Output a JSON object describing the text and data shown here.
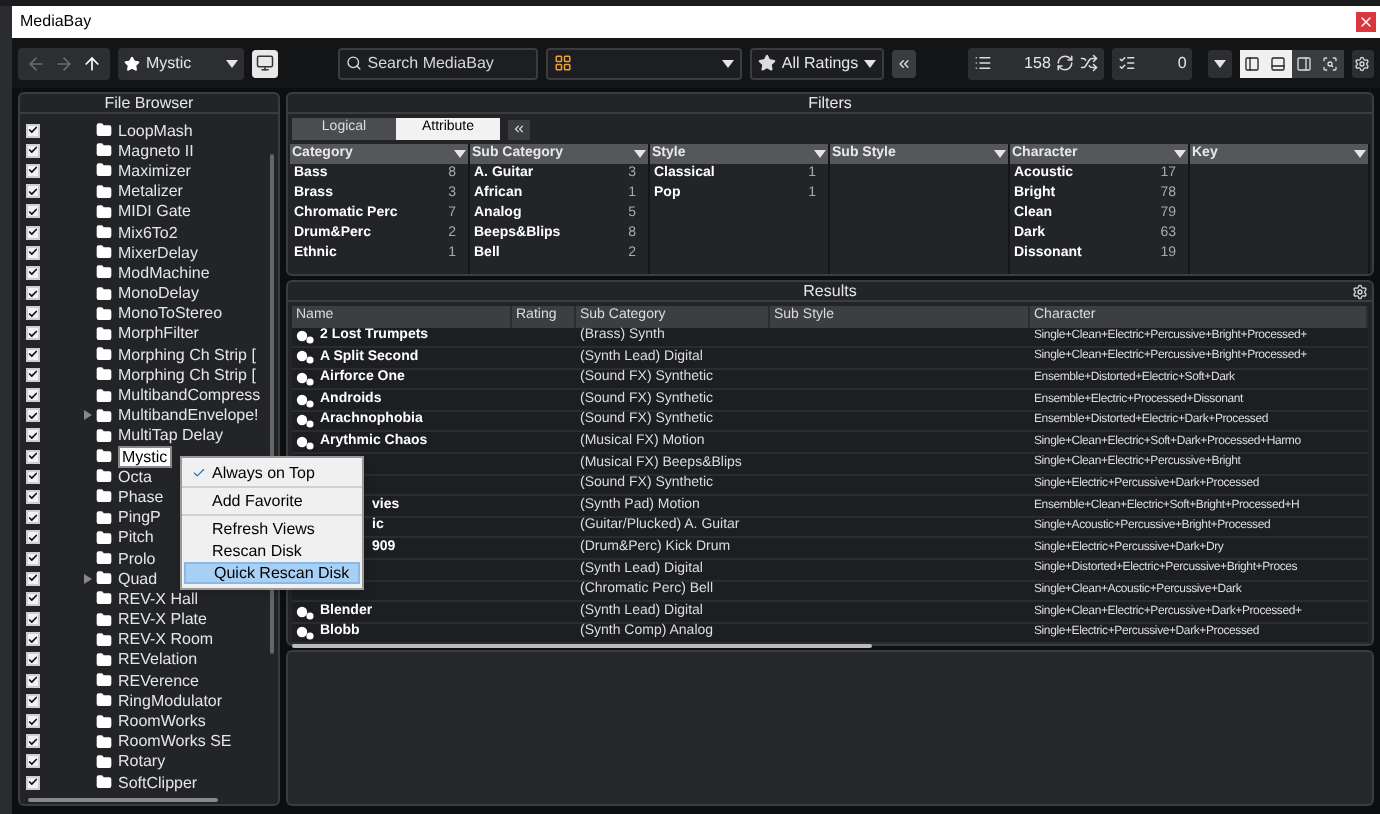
{
  "window": {
    "title": "MediaBay"
  },
  "toolbar": {
    "location": "Mystic",
    "search_placeholder": "Search MediaBay",
    "ratings": "All Ratings",
    "result_count": "158",
    "selected_count": "0",
    "layouts": [
      {
        "selected": true
      },
      {
        "selected": true
      },
      {
        "selected": false
      },
      {
        "selected": false
      }
    ]
  },
  "file_browser": {
    "title": "File Browser",
    "items": [
      {
        "name": "LoopMash",
        "checked": true,
        "expandable": false,
        "selected": false
      },
      {
        "name": "Magneto II",
        "checked": true,
        "expandable": false,
        "selected": false
      },
      {
        "name": "Maximizer",
        "checked": true,
        "expandable": false,
        "selected": false
      },
      {
        "name": "Metalizer",
        "checked": true,
        "expandable": false,
        "selected": false
      },
      {
        "name": "MIDI Gate",
        "checked": true,
        "expandable": false,
        "selected": false
      },
      {
        "name": "Mix6To2",
        "checked": true,
        "expandable": false,
        "selected": false
      },
      {
        "name": "MixerDelay",
        "checked": true,
        "expandable": false,
        "selected": false
      },
      {
        "name": "ModMachine",
        "checked": true,
        "expandable": false,
        "selected": false
      },
      {
        "name": "MonoDelay",
        "checked": true,
        "expandable": false,
        "selected": false
      },
      {
        "name": "MonoToStereo",
        "checked": true,
        "expandable": false,
        "selected": false
      },
      {
        "name": "MorphFilter",
        "checked": true,
        "expandable": false,
        "selected": false
      },
      {
        "name": "Morphing Ch Strip [",
        "checked": true,
        "expandable": false,
        "selected": false
      },
      {
        "name": "Morphing Ch Strip [",
        "checked": true,
        "expandable": false,
        "selected": false
      },
      {
        "name": "MultibandCompress",
        "checked": true,
        "expandable": false,
        "selected": false
      },
      {
        "name": "MultibandEnvelope!",
        "checked": true,
        "expandable": true,
        "selected": false
      },
      {
        "name": "MultiTap Delay",
        "checked": true,
        "expandable": false,
        "selected": false
      },
      {
        "name": "Mystic",
        "checked": true,
        "expandable": false,
        "selected": true
      },
      {
        "name": "Octa",
        "checked": true,
        "expandable": false,
        "selected": false
      },
      {
        "name": "Phase",
        "checked": true,
        "expandable": false,
        "selected": false
      },
      {
        "name": "PingP",
        "checked": true,
        "expandable": false,
        "selected": false
      },
      {
        "name": "Pitch",
        "checked": true,
        "expandable": false,
        "selected": false
      },
      {
        "name": "Prolo",
        "checked": true,
        "expandable": false,
        "selected": false
      },
      {
        "name": "Quad",
        "checked": true,
        "expandable": true,
        "selected": false
      },
      {
        "name": "REV-X Hall",
        "checked": true,
        "expandable": false,
        "selected": false
      },
      {
        "name": "REV-X Plate",
        "checked": true,
        "expandable": false,
        "selected": false
      },
      {
        "name": "REV-X Room",
        "checked": true,
        "expandable": false,
        "selected": false
      },
      {
        "name": "REVelation",
        "checked": true,
        "expandable": false,
        "selected": false
      },
      {
        "name": "REVerence",
        "checked": true,
        "expandable": false,
        "selected": false
      },
      {
        "name": "RingModulator",
        "checked": true,
        "expandable": false,
        "selected": false
      },
      {
        "name": "RoomWorks",
        "checked": true,
        "expandable": false,
        "selected": false
      },
      {
        "name": "RoomWorks SE",
        "checked": true,
        "expandable": false,
        "selected": false
      },
      {
        "name": "Rotary",
        "checked": true,
        "expandable": false,
        "selected": false
      },
      {
        "name": "SoftClipper",
        "checked": true,
        "expandable": false,
        "selected": false
      }
    ]
  },
  "context_menu": {
    "groups": [
      [
        {
          "label": "Always on Top",
          "checked": true,
          "selected": false
        }
      ],
      [
        {
          "label": "Add Favorite",
          "checked": false,
          "selected": false
        }
      ],
      [
        {
          "label": "Refresh Views",
          "checked": false,
          "selected": false
        },
        {
          "label": "Rescan Disk",
          "checked": false,
          "selected": false
        },
        {
          "label": "Quick Rescan Disk",
          "checked": false,
          "selected": true
        }
      ]
    ]
  },
  "filters": {
    "title": "Filters",
    "tabs": [
      {
        "label": "Logical",
        "selected": false
      },
      {
        "label": "Attribute",
        "selected": true
      }
    ],
    "columns": [
      {
        "title": "Category",
        "items": [
          {
            "label": "Bass",
            "count": "8"
          },
          {
            "label": "Brass",
            "count": "3"
          },
          {
            "label": "Chromatic Perc",
            "count": "7"
          },
          {
            "label": "Drum&Perc",
            "count": "2"
          },
          {
            "label": "Ethnic",
            "count": "1"
          }
        ]
      },
      {
        "title": "Sub Category",
        "items": [
          {
            "label": "A. Guitar",
            "count": "3"
          },
          {
            "label": "African",
            "count": "1"
          },
          {
            "label": "Analog",
            "count": "5"
          },
          {
            "label": "Beeps&Blips",
            "count": "8"
          },
          {
            "label": "Bell",
            "count": "2"
          }
        ]
      },
      {
        "title": "Style",
        "items": [
          {
            "label": "Classical",
            "count": "1"
          },
          {
            "label": "Pop",
            "count": "1"
          }
        ]
      },
      {
        "title": "Sub Style"
      },
      {
        "title": "Character",
        "items": [
          {
            "label": "Acoustic",
            "count": "17"
          },
          {
            "label": "Bright",
            "count": "78"
          },
          {
            "label": "Clean",
            "count": "79"
          },
          {
            "label": "Dark",
            "count": "63"
          },
          {
            "label": "Dissonant",
            "count": "19"
          }
        ]
      },
      {
        "title": "Key"
      }
    ]
  },
  "results": {
    "title": "Results",
    "columns": [
      "Name",
      "Rating",
      "Sub Category",
      "Sub Style",
      "Character"
    ],
    "rows": [
      {
        "kind": "full",
        "name": "2 Lost Trumpets",
        "sub_category": "(Brass) Synth",
        "character": "Single+Clean+Electric+Percussive+Bright+Processed+"
      },
      {
        "kind": "full",
        "name": "A Split Second",
        "sub_category": "(Synth Lead) Digital",
        "character": "Single+Clean+Electric+Percussive+Bright+Processed+"
      },
      {
        "kind": "full",
        "name": "Airforce One",
        "sub_category": "(Sound FX) Synthetic",
        "character": "Ensemble+Distorted+Electric+Soft+Dark"
      },
      {
        "kind": "full",
        "name": "Androids",
        "sub_category": "(Sound FX) Synthetic",
        "character": "Ensemble+Electric+Processed+Dissonant"
      },
      {
        "kind": "full",
        "name": "Arachnophobia",
        "sub_category": "(Sound FX) Synthetic",
        "character": "Ensemble+Distorted+Electric+Dark+Processed"
      },
      {
        "kind": "full",
        "name": "Arythmic Chaos",
        "sub_category": "(Musical FX) Motion",
        "character": "Single+Clean+Electric+Soft+Dark+Processed+Harmo"
      },
      {
        "kind": "hidden",
        "sub_category": "(Musical FX) Beeps&Blips",
        "character": "Single+Clean+Electric+Percussive+Bright"
      },
      {
        "kind": "hidden",
        "sub_category": "(Sound FX) Synthetic",
        "character": "Single+Electric+Percussive+Dark+Processed"
      },
      {
        "kind": "partial",
        "name": "vies",
        "sub_category": "(Synth Pad) Motion",
        "character": "Ensemble+Clean+Electric+Soft+Bright+Processed+H"
      },
      {
        "kind": "partial",
        "name": "ic",
        "sub_category": "(Guitar/Plucked) A. Guitar",
        "character": "Single+Acoustic+Percussive+Bright+Processed"
      },
      {
        "kind": "partial",
        "name": "909",
        "sub_category": "(Drum&Perc) Kick Drum",
        "character": "Single+Electric+Percussive+Dark+Dry"
      },
      {
        "kind": "hidden",
        "sub_category": "(Synth Lead) Digital",
        "character": "Single+Distorted+Electric+Percussive+Bright+Proces"
      },
      {
        "kind": "hidden",
        "sub_category": "(Chromatic Perc) Bell",
        "character": "Single+Clean+Acoustic+Percussive+Dark"
      },
      {
        "kind": "full",
        "name": "Blender",
        "sub_category": "(Synth Lead) Digital",
        "character": "Single+Clean+Electric+Percussive+Dark+Processed+"
      },
      {
        "kind": "full",
        "name": "Blobb",
        "sub_category": "(Synth Comp) Analog",
        "character": "Single+Electric+Percussive+Dark+Processed"
      }
    ]
  }
}
